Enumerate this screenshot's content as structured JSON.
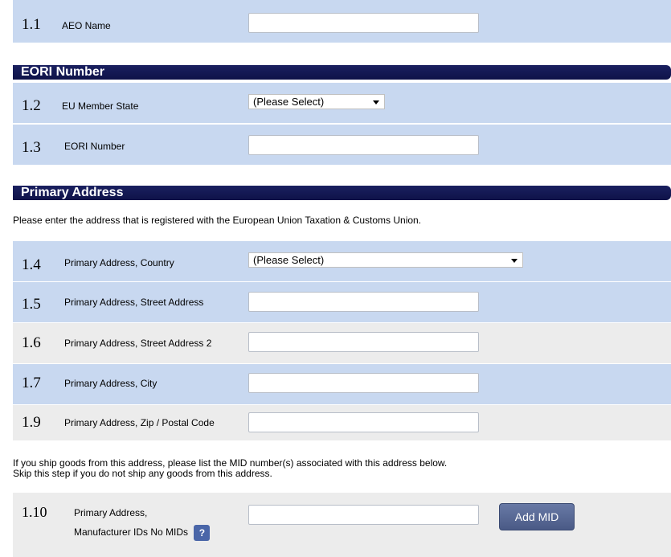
{
  "fields": {
    "aeo_name": {
      "num": "1.1",
      "label": "AEO Name",
      "value": ""
    },
    "eu_member_state": {
      "num": "1.2",
      "label": "EU Member State",
      "selected": "(Please Select)"
    },
    "eori_number": {
      "num": "1.3",
      "label": "EORI Number",
      "value": ""
    },
    "country": {
      "num": "1.4",
      "label": "Primary Address, Country",
      "selected": "(Please Select)"
    },
    "street": {
      "num": "1.5",
      "label": "Primary Address, Street Address",
      "value": ""
    },
    "street2": {
      "num": "1.6",
      "label": "Primary Address, Street Address 2",
      "value": ""
    },
    "city": {
      "num": "1.7",
      "label": "Primary Address, City",
      "value": ""
    },
    "zip": {
      "num": "1.9",
      "label": "Primary Address, Zip / Postal Code",
      "value": ""
    },
    "mid": {
      "num": "1.10",
      "label_line1": "Primary Address,",
      "label_line2": "Manufacturer IDs",
      "no_mids": "No MIDs",
      "help": "?",
      "add_label": "Add MID",
      "value": ""
    }
  },
  "sections": {
    "eori": "EORI Number",
    "primary_address": "Primary Address"
  },
  "notes": {
    "address": "Please enter the address that is registered with the European Union Taxation & Customs Union.",
    "mid_line1": "If you ship goods from this address, please list the MID number(s) associated with this address below.",
    "mid_line2": "Skip this step if you do not ship any goods from this address."
  }
}
